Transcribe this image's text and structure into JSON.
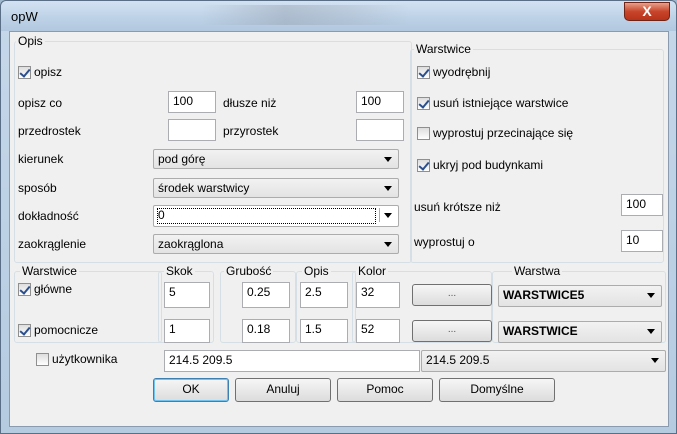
{
  "window": {
    "title": "opW",
    "close_glyph": "X"
  },
  "opis_group": {
    "title": "Opis",
    "opisz": {
      "label": "opisz",
      "checked": true
    },
    "opisz_co": {
      "label": "opisz co",
      "value": "100"
    },
    "dluzsze_niz": {
      "label": "dłusze niż",
      "value": "100"
    },
    "przedrostek": {
      "label": "przedrostek",
      "value": ""
    },
    "przyrostek": {
      "label": "przyrostek",
      "value": ""
    },
    "kierunek": {
      "label": "kierunek",
      "value": "pod górę"
    },
    "sposob": {
      "label": "sposób",
      "value": "środek warstwicy"
    },
    "dokladnosc": {
      "label": "dokładność",
      "value": "0"
    },
    "zaokraglenie": {
      "label": "zaokrąglenie",
      "value": "zaokrąglona"
    }
  },
  "warstwice_group": {
    "title": "Warstwice",
    "wyodrebnij": {
      "label": "wyodrębnij",
      "checked": true
    },
    "usun_istniejace": {
      "label": "usuń istniejące warstwice",
      "checked": true
    },
    "wyprostuj_przecinajace": {
      "label": "wyprostuj przecinające się",
      "checked": false
    },
    "ukryj_pod_budynkami": {
      "label": "ukryj pod budynkami",
      "checked": true
    },
    "usun_krotsze": {
      "label": "usuń krótsze niż",
      "value": "100"
    },
    "wyprostuj_o": {
      "label": "wyprostuj o",
      "value": "10"
    }
  },
  "layers": {
    "group_title": "Warstwice",
    "headers": {
      "skok": "Skok",
      "grubosc": "Grubość",
      "opis": "Opis",
      "kolor": "Kolor",
      "warstwa": "Warstwa"
    },
    "color_button_label": "...",
    "glowne": {
      "label": "główne",
      "checked": true,
      "skok": "5",
      "grubosc": "0.25",
      "opis": "2.5",
      "kolor": "32",
      "warstwa": "WARSTWICE5"
    },
    "pomocnicze": {
      "label": "pomocnicze",
      "checked": true,
      "skok": "1",
      "grubosc": "0.18",
      "opis": "1.5",
      "kolor": "52",
      "warstwa": "WARSTWICE"
    },
    "uzytkownika": {
      "label": "użytkownika",
      "checked": false,
      "value": "214.5 209.5",
      "combo": "214.5 209.5"
    }
  },
  "buttons": {
    "ok": "OK",
    "anuluj": "Anuluj",
    "pomoc": "Pomoc",
    "domyslne": "Domyślne"
  }
}
